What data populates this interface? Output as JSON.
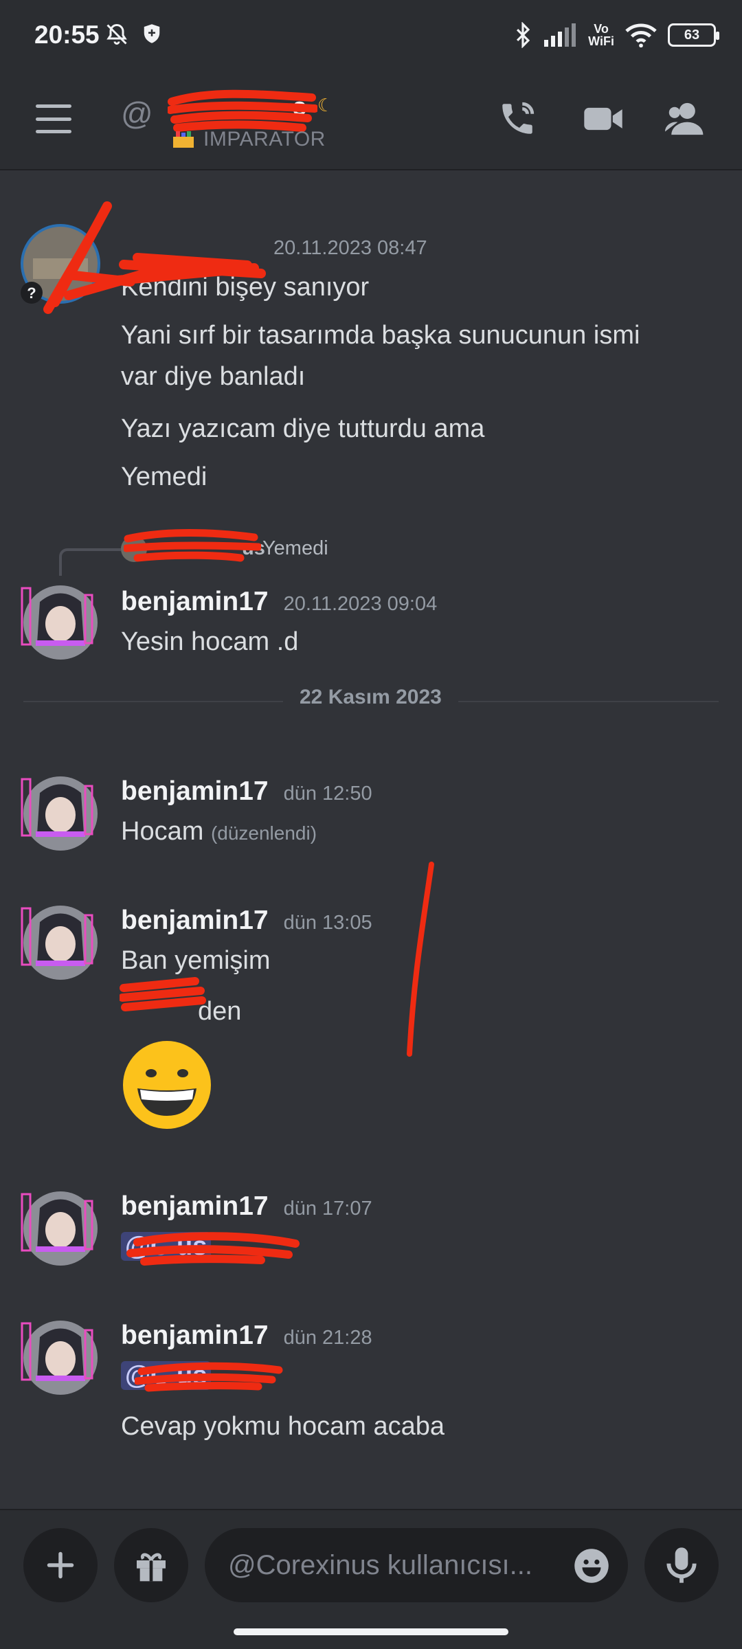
{
  "status_bar": {
    "time": "20:55",
    "vowifi_top": "Vo",
    "vowifi_bottom": "WiFi",
    "battery": "63",
    "icons_left": [
      "bell-off-icon",
      "shield-icon"
    ],
    "icons_right": [
      "bluetooth-icon",
      "signal-icon",
      "vowifi-icon",
      "wifi-icon",
      "battery-icon"
    ]
  },
  "header": {
    "at": "@",
    "name_visible_tail": "s",
    "subtitle": "IMPARATOR",
    "icons": [
      "menu-icon",
      "phone-call-icon",
      "video-call-icon",
      "members-icon"
    ]
  },
  "messages": [
    {
      "author": "",
      "timestamp": "20.11.2023 08:47",
      "lines": [
        "Kendini bişey sanıyor",
        "Yani sırf bir tasarımda başka sunucunun ismi",
        "var diye banladı",
        "Yazı yazıcam diye tutturdu ama",
        "Yemedi"
      ]
    },
    {
      "reply_author_tail": "us",
      "reply_preview": "Yemedi",
      "author": "benjamin17",
      "timestamp": "20.11.2023 09:04",
      "lines": [
        "Yesin hocam .d"
      ]
    }
  ],
  "date_divider": "22 Kasım 2023",
  "messages_after": [
    {
      "author": "benjamin17",
      "timestamp": "dün 12:50",
      "text": "Hocam",
      "edited": "(düzenlendi)"
    },
    {
      "author": "benjamin17",
      "timestamp": "dün 13:05",
      "lines": [
        "Ban yemişim",
        "den"
      ],
      "emoji": "grinning-face-icon"
    },
    {
      "author": "benjamin17",
      "timestamp": "dün 17:07",
      "mention": "@C    us"
    },
    {
      "author": "benjamin17",
      "timestamp": "dün 21:28",
      "mention": "@C    us",
      "text": "Cevap yokmu hocam acaba"
    }
  ],
  "composer": {
    "placeholder": "@Corexinus kullanıcısı...",
    "icons": [
      "plus-icon",
      "gift-icon",
      "emoji-icon",
      "microphone-icon"
    ]
  },
  "colors": {
    "background": "#313338",
    "header": "#2b2d31",
    "scribble": "#ef2b12",
    "mention_bg": "#40447a"
  }
}
